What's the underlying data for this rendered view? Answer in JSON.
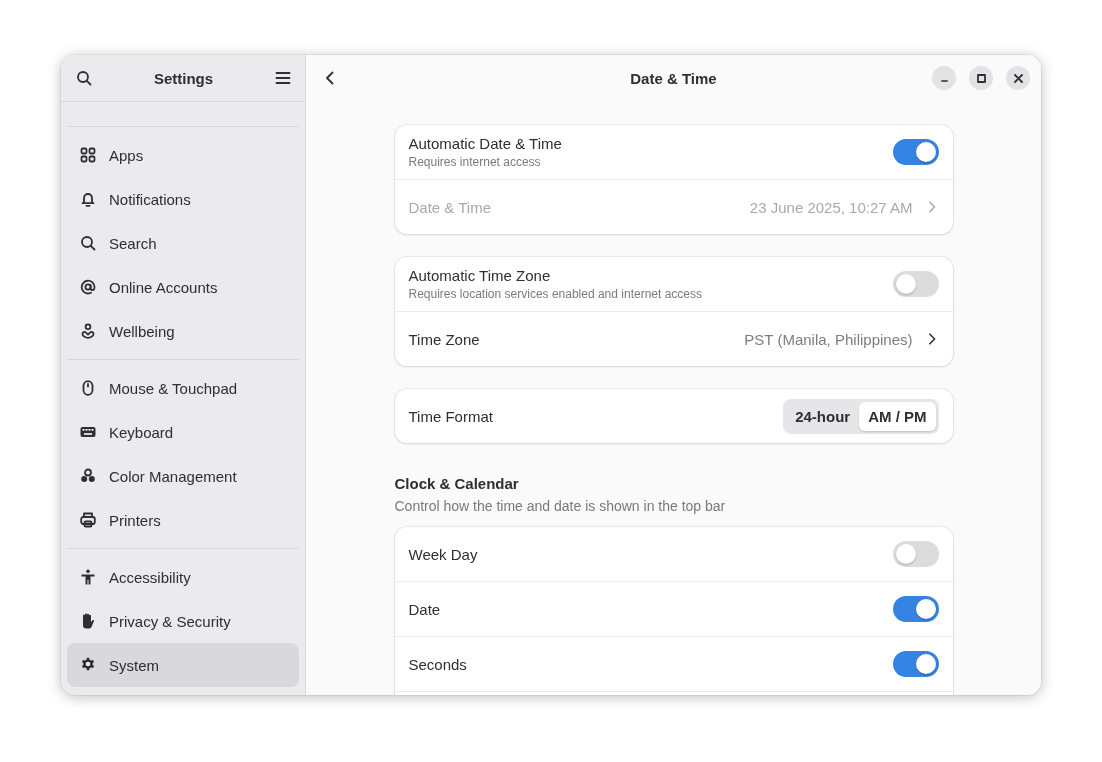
{
  "sidebar": {
    "title": "Settings",
    "groups": [
      {
        "items": [
          {
            "label": "Apps",
            "selected": false
          },
          {
            "label": "Notifications",
            "selected": false
          },
          {
            "label": "Search",
            "selected": false
          },
          {
            "label": "Online Accounts",
            "selected": false
          },
          {
            "label": "Wellbeing",
            "selected": false
          }
        ]
      },
      {
        "items": [
          {
            "label": "Mouse & Touchpad",
            "selected": false
          },
          {
            "label": "Keyboard",
            "selected": false
          },
          {
            "label": "Color Management",
            "selected": false
          },
          {
            "label": "Printers",
            "selected": false
          }
        ]
      },
      {
        "items": [
          {
            "label": "Accessibility",
            "selected": false
          },
          {
            "label": "Privacy & Security",
            "selected": false
          },
          {
            "label": "System",
            "selected": true
          }
        ]
      }
    ]
  },
  "page": {
    "title": "Date & Time",
    "sections": [
      {
        "rows": [
          {
            "kind": "switch",
            "title": "Automatic Date & Time",
            "subtitle": "Requires internet access",
            "on": true
          },
          {
            "kind": "link",
            "title": "Date & Time",
            "value": "23 June 2025, 10:27 AM",
            "disabled": true
          }
        ]
      },
      {
        "rows": [
          {
            "kind": "switch",
            "title": "Automatic Time Zone",
            "subtitle": "Requires location services enabled and internet access",
            "on": false
          },
          {
            "kind": "link",
            "title": "Time Zone",
            "value": "PST (Manila, Philippines)",
            "disabled": false
          }
        ]
      },
      {
        "rows": [
          {
            "kind": "choice",
            "title": "Time Format",
            "options": [
              {
                "label": "24-hour",
                "selected": false
              },
              {
                "label": "AM / PM",
                "selected": true
              }
            ]
          }
        ]
      },
      {
        "heading": "Clock & Calendar",
        "description": "Control how the time and date is shown in the top bar",
        "rows": [
          {
            "kind": "switch",
            "title": "Week Day",
            "on": false
          },
          {
            "kind": "switch",
            "title": "Date",
            "on": true
          },
          {
            "kind": "switch",
            "title": "Seconds",
            "on": true
          }
        ],
        "more": true
      }
    ]
  }
}
